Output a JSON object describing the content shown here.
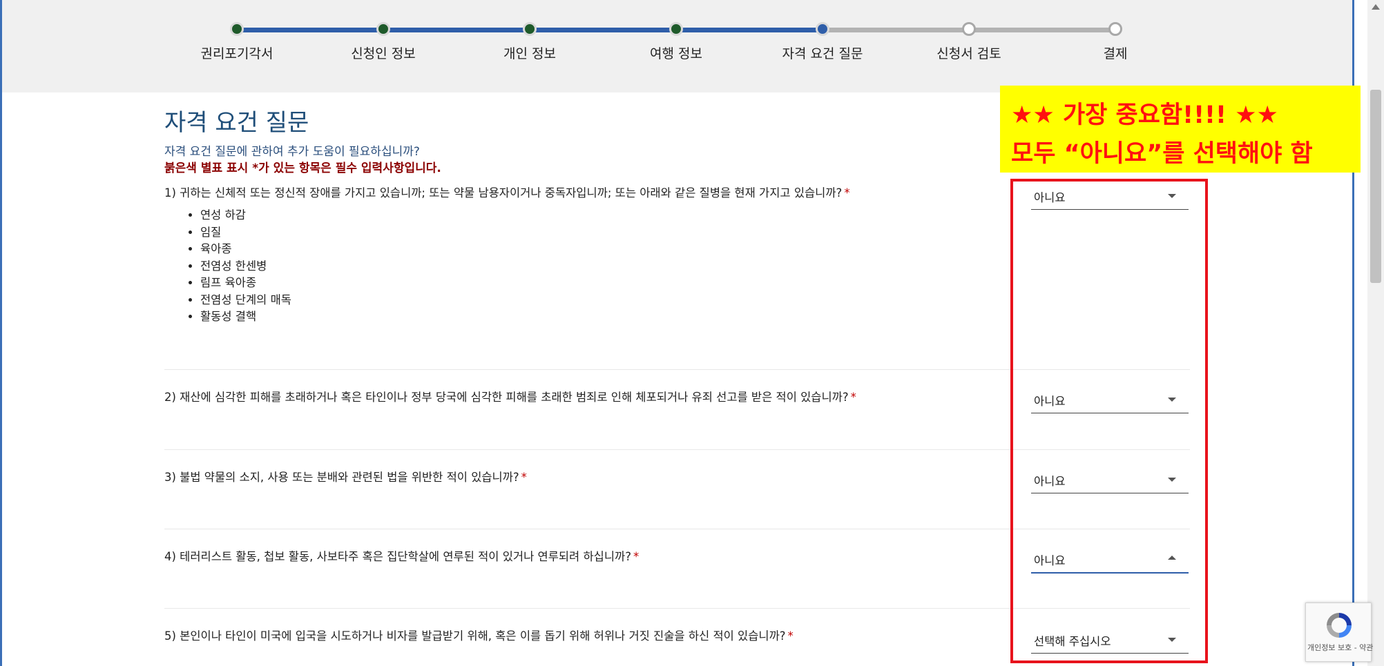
{
  "progress": {
    "steps": [
      {
        "label": "권리포기각서",
        "state": "done"
      },
      {
        "label": "신청인 정보",
        "state": "done"
      },
      {
        "label": "개인 정보",
        "state": "done"
      },
      {
        "label": "여행 정보",
        "state": "done"
      },
      {
        "label": "자격 요건 질문",
        "state": "current"
      },
      {
        "label": "신청서 검토",
        "state": "todo"
      },
      {
        "label": "결제",
        "state": "todo"
      }
    ],
    "colors": {
      "done": "#2f5ea9",
      "todo": "#b3b3b3"
    }
  },
  "page": {
    "title": "자격 요건 질문",
    "help_text": "자격 요건 질문에 관하여 추가 도움이 필요하십니까?",
    "required_note": "붉은색 별표 표시 *가 있는 항목은 필수 입력사항입니다."
  },
  "questions": [
    {
      "text": "1) 귀하는 신체적 또는 정신적 장애를 가지고 있습니까; 또는 약물 남용자이거나 중독자입니까; 또는 아래와 같은 질병을 현재 가지고 있습니까?",
      "required_mark": "*",
      "answer": "아니요",
      "conditions": [
        "연성 하감",
        "임질",
        "육아종",
        "전염성 한센병",
        "림프 육아종",
        "전염성 단계의 매독",
        "활동성 결핵"
      ]
    },
    {
      "text": "2) 재산에 심각한 피해를 초래하거나 혹은 타인이나 정부 당국에 심각한 피해를 초래한 범죄로 인해 체포되거나 유죄 선고를 받은 적이 있습니까?",
      "required_mark": "*",
      "answer": "아니요"
    },
    {
      "text": "3) 불법 약물의 소지, 사용 또는 분배와 관련된 법을 위반한 적이 있습니까?",
      "required_mark": "*",
      "answer": "아니요"
    },
    {
      "text": "4) 테러리스트 활동, 첩보 활동, 사보타주 혹은 집단학살에 연루된 적이 있거나 연루되려 하십니까?",
      "required_mark": "*",
      "answer": "아니요",
      "dropdown_open": true
    },
    {
      "text": "5) 본인이나 타인이 미국에 입국을 시도하거나 비자를 발급받기 위해, 혹은 이를 돕기 위해 허위나 거짓 진술을 하신 적이 있습니까?",
      "required_mark": "*",
      "answer": "선택해 주십시오"
    }
  ],
  "annotation": {
    "line1": "★★ 가장 중요함!!!! ★★",
    "line2": "모두 “아니요”를 선택해야 함",
    "box_color": "#ffff00",
    "text_color": "#ff1010",
    "frame_color": "#e8131c"
  },
  "recaptcha": {
    "text": "개인정보 보호 - 약관"
  }
}
